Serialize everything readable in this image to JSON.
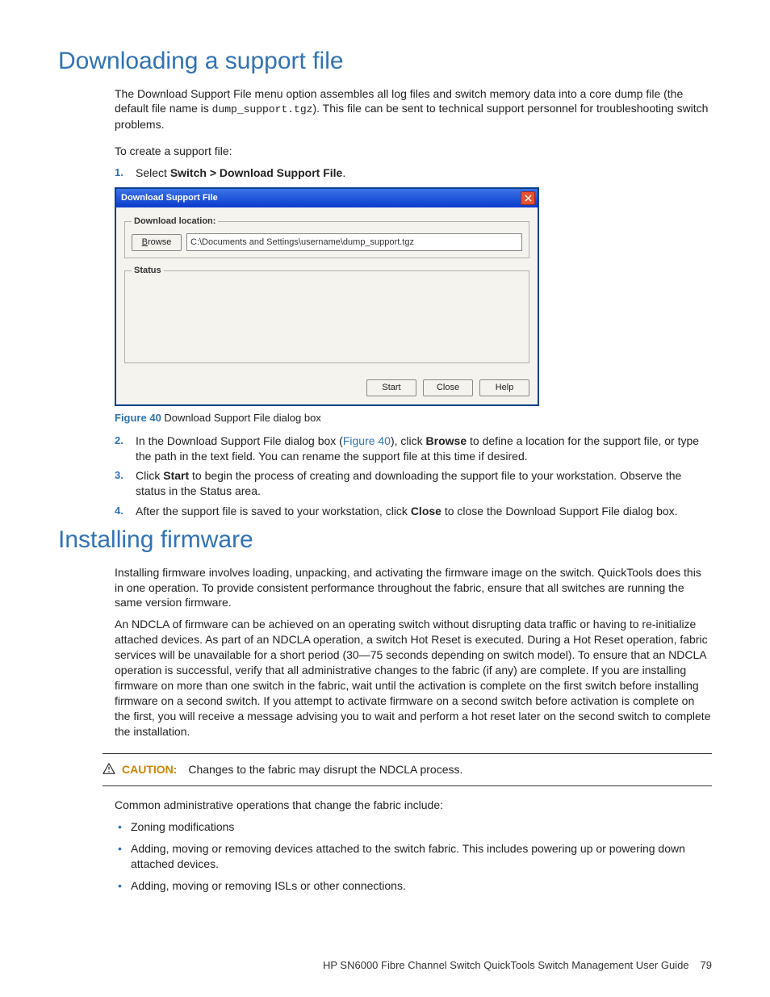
{
  "section1": {
    "heading": "Downloading a support file",
    "intro_1": "The Download Support File menu option assembles all log files and switch memory data into a core dump file (the default file name is ",
    "filename": "dump_support.tgz",
    "intro_2": "). This file can be sent to technical support personnel for troubleshooting switch problems.",
    "create_line": "To create a support file:",
    "step1": {
      "num": "1.",
      "pre": "Select ",
      "bold": "Switch > Download Support File",
      "post": "."
    },
    "dialog": {
      "title": "Download Support File",
      "legend_dl": "Download location:",
      "browse": "Browse",
      "path": "C:\\Documents and Settings\\username\\dump_support.tgz",
      "legend_status": "Status",
      "start": "Start",
      "close": "Close",
      "help": "Help"
    },
    "figure": {
      "label": "Figure 40",
      "caption": " Download Support File dialog box"
    },
    "step2": {
      "num": "2.",
      "pre": "In the Download Support File dialog box (",
      "link": "Figure 40",
      "mid": "), click ",
      "bold": "Browse",
      "post": " to define a location for the support file, or type the path in the text field. You can rename the support file at this time if desired."
    },
    "step3": {
      "num": "3.",
      "pre": "Click ",
      "bold": "Start",
      "post": " to begin the process of creating and downloading the support file to your workstation. Observe the status in the Status area."
    },
    "step4": {
      "num": "4.",
      "pre": "After the support file is saved to your workstation, click ",
      "bold": "Close",
      "post": " to close the Download Support File dialog box."
    }
  },
  "section2": {
    "heading": "Installing firmware",
    "p1": "Installing firmware involves loading, unpacking, and activating the firmware image on the switch. QuickTools does this in one operation. To provide consistent performance throughout the fabric, ensure that all switches are running the same version firmware.",
    "p2": "An NDCLA of firmware can be achieved on an operating switch without disrupting data traffic or having to re-initialize attached devices. As part of an NDCLA operation, a switch Hot Reset is executed. During a Hot Reset operation, fabric services will be unavailable for a short period (30—75 seconds depending on switch model). To ensure that an NDCLA operation is successful, verify that all administrative changes to the fabric (if any) are complete. If you are installing firmware on more than one switch in the fabric, wait until the activation is complete on the first switch before installing firmware on a second switch. If you attempt to activate firmware on a second switch before activation is complete on the first, you will receive a message advising you to wait and perform a hot reset later on the second switch to complete the installation.",
    "caution": {
      "label": "CAUTION:",
      "text": "Changes to the fabric may disrupt the NDCLA process."
    },
    "p3": "Common administrative operations that change the fabric include:",
    "bullets": [
      "Zoning modifications",
      "Adding, moving or removing devices attached to the switch fabric. This includes powering up or powering down attached devices.",
      "Adding, moving or removing ISLs or other connections."
    ]
  },
  "footer": {
    "title": "HP SN6000 Fibre Channel Switch QuickTools Switch Management User Guide",
    "page": "79"
  }
}
